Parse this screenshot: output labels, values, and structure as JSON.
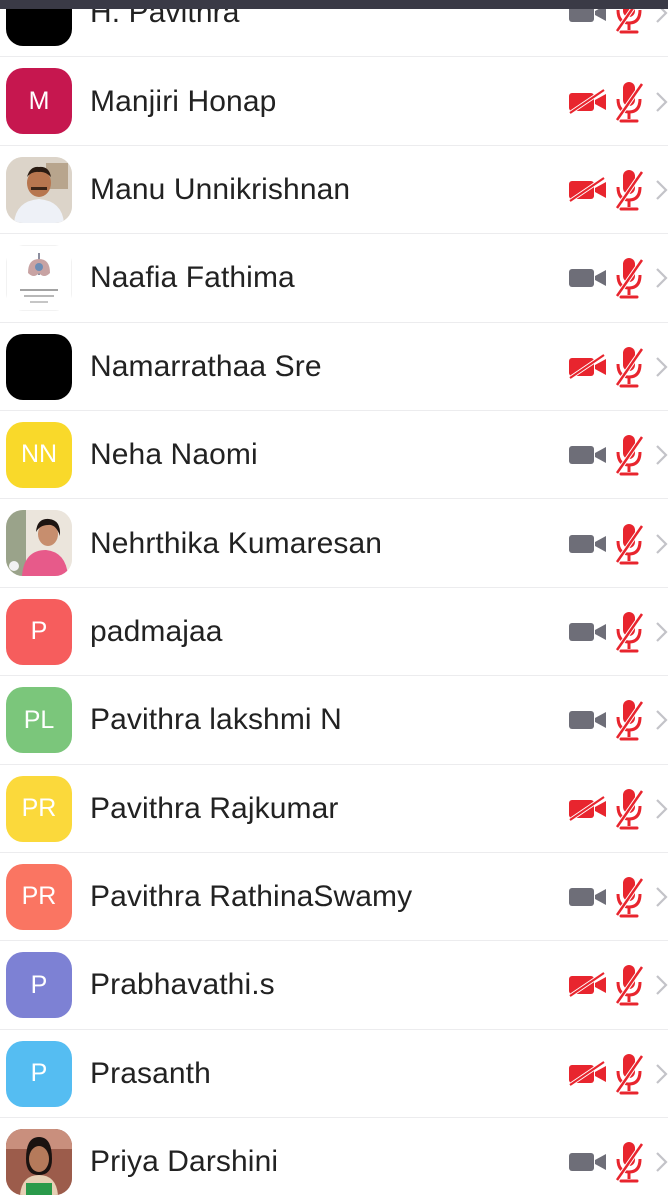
{
  "colors": {
    "muted_red": "#e8252e",
    "video_gray": "#6e6e78",
    "chevron_gray": "#c3c3c8",
    "divider": "#ececee"
  },
  "participants": [
    {
      "name": "H. Pavithra",
      "avatar": {
        "type": "image",
        "icon": "black-avatar",
        "bg": "#000000",
        "initials": ""
      },
      "video": "off-gray",
      "mic": "muted"
    },
    {
      "name": "Manjiri Honap",
      "avatar": {
        "type": "initials",
        "initials": "M",
        "bg": "#c6174f"
      },
      "video": "muted",
      "mic": "muted"
    },
    {
      "name": "Manu Unnikrishnan",
      "avatar": {
        "type": "image",
        "icon": "man-photo-avatar",
        "bg": "#d9d2c8",
        "initials": ""
      },
      "video": "muted",
      "mic": "muted"
    },
    {
      "name": "Naafia Fathima",
      "avatar": {
        "type": "image",
        "icon": "logo-avatar",
        "bg": "#ffffff",
        "initials": ""
      },
      "video": "on",
      "mic": "muted"
    },
    {
      "name": "Namarrathaa Sre",
      "avatar": {
        "type": "image",
        "icon": "black-avatar",
        "bg": "#000000",
        "initials": ""
      },
      "video": "muted",
      "mic": "muted"
    },
    {
      "name": "Neha Naomi",
      "avatar": {
        "type": "initials",
        "initials": "NN",
        "bg": "#f9d92a"
      },
      "video": "on",
      "mic": "muted"
    },
    {
      "name": "Nehrthika Kumaresan",
      "avatar": {
        "type": "image",
        "icon": "woman-photo-avatar",
        "bg": "#e8e2da",
        "initials": ""
      },
      "video": "on",
      "mic": "muted"
    },
    {
      "name": "padmajaa",
      "avatar": {
        "type": "initials",
        "initials": "P",
        "bg": "#f65d5d"
      },
      "video": "on",
      "mic": "muted"
    },
    {
      "name": "Pavithra lakshmi N",
      "avatar": {
        "type": "initials",
        "initials": "PL",
        "bg": "#7bc67b"
      },
      "video": "on",
      "mic": "muted"
    },
    {
      "name": "Pavithra Rajkumar",
      "avatar": {
        "type": "initials",
        "initials": "PR",
        "bg": "#fbd93b"
      },
      "video": "muted",
      "mic": "muted"
    },
    {
      "name": "Pavithra RathinaSwamy",
      "avatar": {
        "type": "initials",
        "initials": "PR",
        "bg": "#fa7562"
      },
      "video": "on",
      "mic": "muted"
    },
    {
      "name": "Prabhavathi.s",
      "avatar": {
        "type": "initials",
        "initials": "P",
        "bg": "#7d81d4"
      },
      "video": "muted",
      "mic": "muted"
    },
    {
      "name": "Prasanth",
      "avatar": {
        "type": "initials",
        "initials": "P",
        "bg": "#55bdf2"
      },
      "video": "muted",
      "mic": "muted"
    },
    {
      "name": "Priya Darshini",
      "avatar": {
        "type": "image",
        "icon": "girl-photo-avatar",
        "bg": "#a86a5a",
        "initials": ""
      },
      "video": "on",
      "mic": "muted"
    }
  ]
}
